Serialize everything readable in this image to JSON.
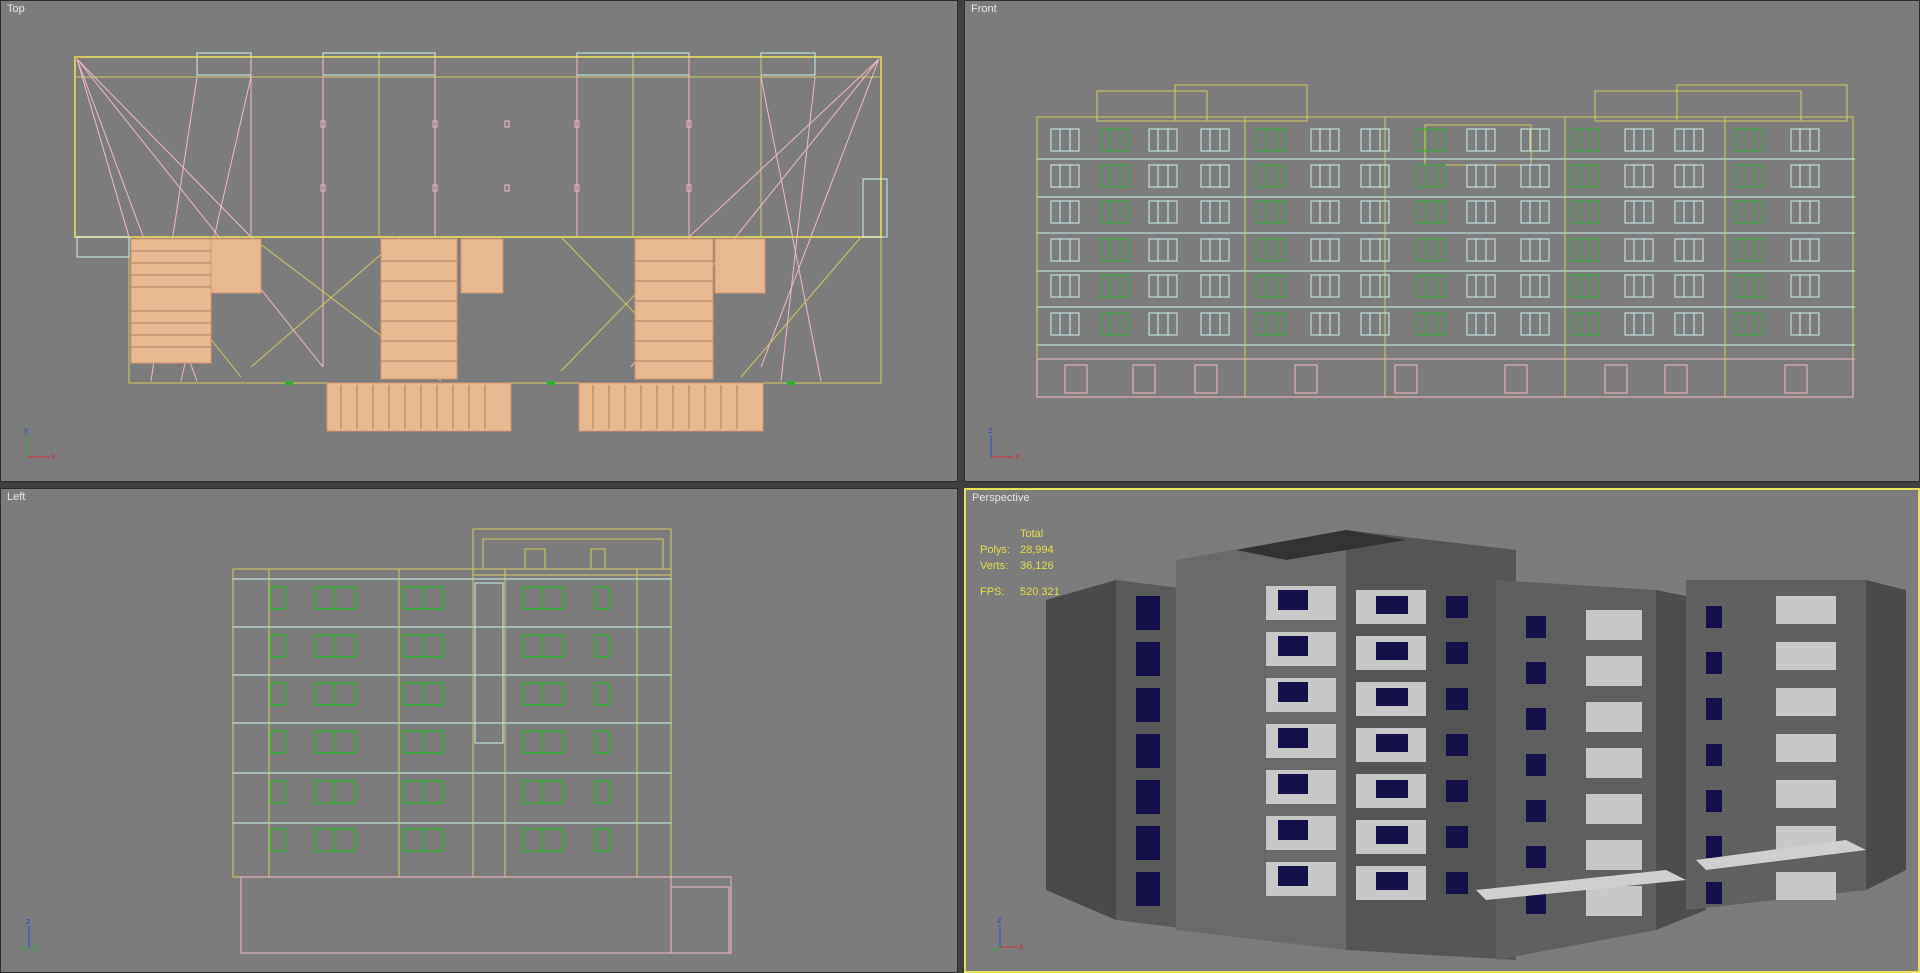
{
  "viewports": {
    "top": {
      "label": "Top"
    },
    "front": {
      "label": "Front"
    },
    "left": {
      "label": "Left"
    },
    "perspective": {
      "label": "Perspective"
    }
  },
  "axes": {
    "top": {
      "a": "y",
      "b": "x"
    },
    "front": {
      "a": "z",
      "b": "x"
    },
    "left": {
      "a": "z",
      "b": "y"
    },
    "perspective": {
      "a": "z",
      "b": "x"
    }
  },
  "stats": {
    "header": "Total",
    "polys_label": "Polys:",
    "polys_value": "28,994",
    "verts_label": "Verts:",
    "verts_value": "36,126",
    "fps_label": "FPS:",
    "fps_value": "520.321"
  },
  "colors": {
    "viewport_bg": "#7c7c7c",
    "active_border": "#e8e25a",
    "stats_text": "#e6dc4a",
    "wire_yellow": "#d4c860",
    "wire_pink": "#f0b8c0",
    "wire_green": "#2fb02f",
    "wire_cyan": "#c8f0f0",
    "glass_blue": "#14104a"
  },
  "icons": [
    "axis-tripod-icon"
  ]
}
